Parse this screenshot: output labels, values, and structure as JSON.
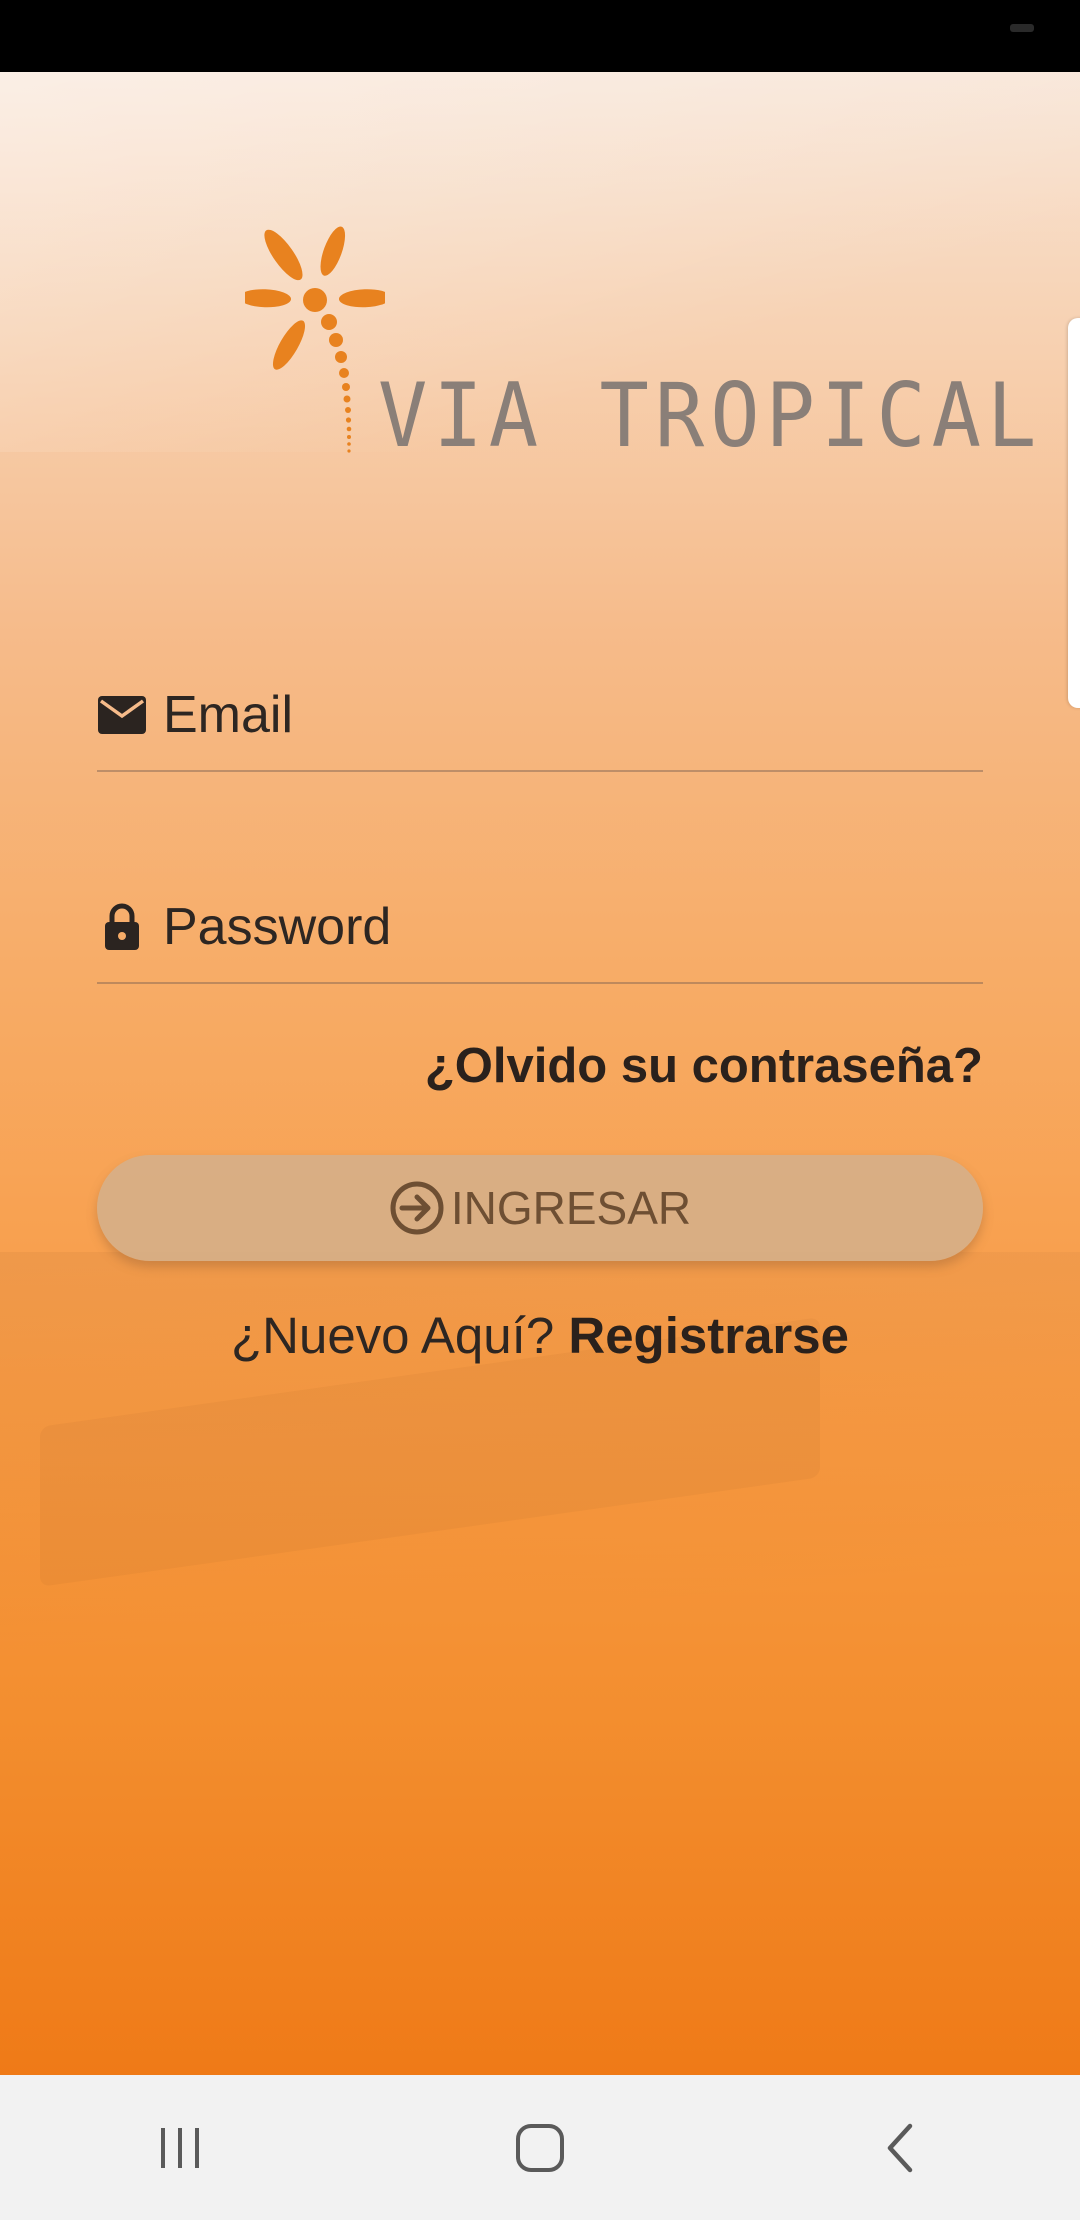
{
  "app": {
    "name": "VIA TROPICAL",
    "brand_color": "#ef7a17",
    "logo_icon": "palm-tree-icon"
  },
  "login_form": {
    "email": {
      "placeholder": "Email",
      "value": "",
      "icon": "envelope-icon"
    },
    "password": {
      "placeholder": "Password",
      "value": "",
      "icon": "lock-icon"
    },
    "forgot_password_label": "¿Olvido su contraseña?",
    "submit": {
      "label": "INGRESAR",
      "icon": "login-arrow-icon"
    },
    "signup_prompt": "¿Nuevo Aquí?",
    "signup_label": "Registrarse"
  },
  "system_nav": {
    "recents_icon": "recents-icon",
    "home_icon": "home-icon",
    "back_icon": "back-icon"
  }
}
